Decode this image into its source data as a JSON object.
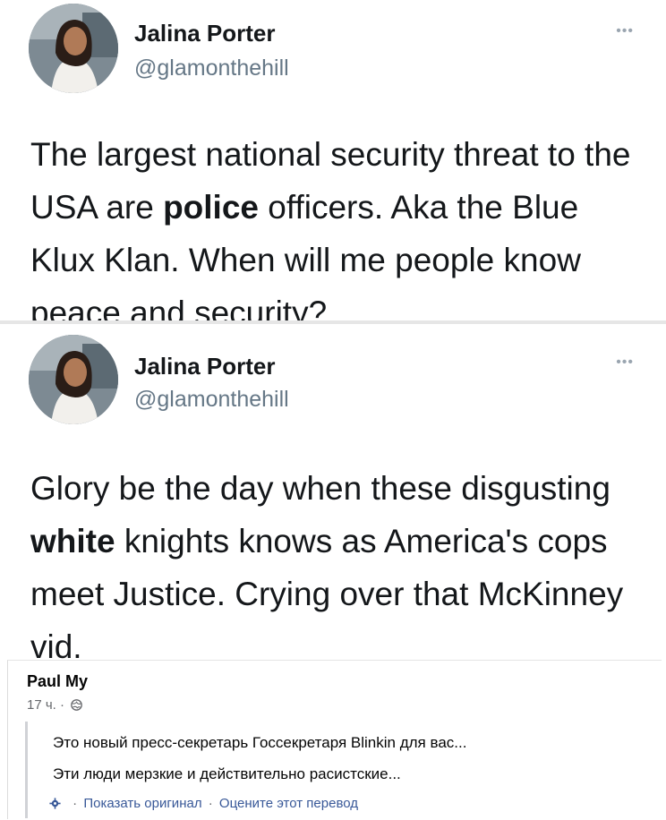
{
  "tweet1": {
    "name": "Jalina Porter",
    "handle": "@glamonthehill",
    "more": "•••",
    "text_part1": "The largest national security threat to the USA are ",
    "text_bold": "police",
    "text_part2": " officers. Aka the Blue Klux Klan. When will me people know peace and security?"
  },
  "tweet2": {
    "name": "Jalina Porter",
    "handle": "@glamonthehill",
    "more": "•••",
    "text_part1": "Glory be the day when these disgusting ",
    "text_bold": "white",
    "text_part2": " knights knows as America's cops meet Justice. Crying over that McKinney vid."
  },
  "comment": {
    "author": "Paul My",
    "time": "17 ч.",
    "dot": "·",
    "line1": "Это новый пресс-секретарь Госсекретаря Blinkin для вас...",
    "line2": "Эти люди мерзкие и действительно расистские...",
    "show_original": "Показать оригинал",
    "rate_translation": "Оцените этот перевод",
    "separator": "·"
  },
  "colors": {
    "name": "#14171a",
    "handle": "#657786",
    "link": "#385898",
    "meta": "#65676b"
  },
  "icons": [
    "avatar-photo",
    "more-options-icon",
    "globe-icon",
    "gear-icon"
  ]
}
